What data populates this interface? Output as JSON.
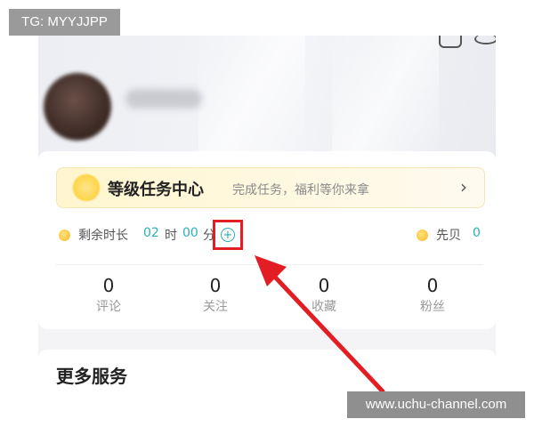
{
  "watermarks": {
    "top_left": "TG: MYYJJPP",
    "bottom_right": "www.uchu-channel.com"
  },
  "profile": {
    "avatar_icon": "avatar-blurred",
    "name": ""
  },
  "level_banner": {
    "icon": "sparkle-star-icon",
    "title": "等级任务中心",
    "subtitle": "完成任务，福利等你来拿",
    "chevron": "›"
  },
  "time_row": {
    "label": "剩余时长",
    "hours": "02",
    "hours_unit": "时",
    "minutes": "00",
    "minutes_unit": "分",
    "plus_icon": "plus-circle-icon",
    "plus_glyph": "+",
    "coins_label": "先贝",
    "coins_value": "0"
  },
  "stats": [
    {
      "value": "0",
      "label": "评论"
    },
    {
      "value": "0",
      "label": "关注"
    },
    {
      "value": "0",
      "label": "收藏"
    },
    {
      "value": "0",
      "label": "粉丝"
    }
  ],
  "services": {
    "title": "更多服务"
  },
  "annotation": {
    "highlight_color": "#e21e24",
    "arrow_color": "#e21e24"
  },
  "colors": {
    "accent": "#2bb0b8",
    "banner_bg": "#fff6cf"
  }
}
